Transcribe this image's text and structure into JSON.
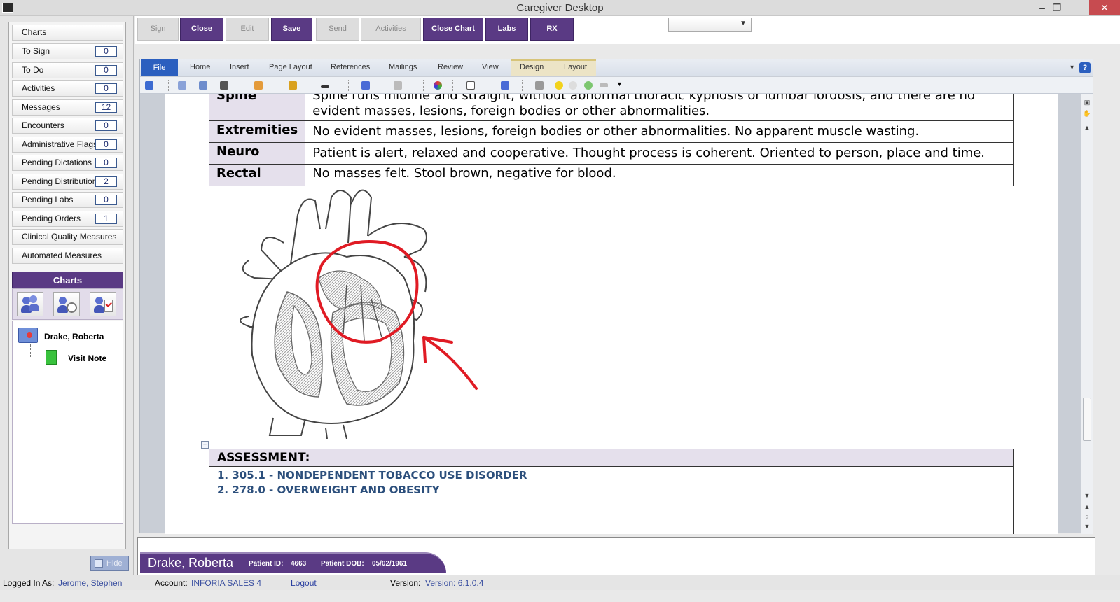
{
  "window": {
    "title": "Caregiver Desktop",
    "minimize": "–",
    "maximize": "❐",
    "close": "✕"
  },
  "sidebar": {
    "items": [
      {
        "label": "Charts",
        "count": null
      },
      {
        "label": "To Sign",
        "count": "0"
      },
      {
        "label": "To Do",
        "count": "0"
      },
      {
        "label": "Activities",
        "count": "0"
      },
      {
        "label": "Messages",
        "count": "12"
      },
      {
        "label": "Encounters",
        "count": "0"
      },
      {
        "label": "Administrative Flags",
        "count": "0"
      },
      {
        "label": "Pending Dictations",
        "count": "0"
      },
      {
        "label": "Pending Distributions",
        "count": "2"
      },
      {
        "label": "Pending Labs",
        "count": "0"
      },
      {
        "label": "Pending Orders",
        "count": "1"
      },
      {
        "label": "Clinical Quality Measures",
        "count": null
      },
      {
        "label": "Automated Measures",
        "count": null
      }
    ],
    "charts_header": "Charts",
    "tree": {
      "patient": "Drake, Roberta",
      "document": "Visit Note"
    },
    "hide_label": "Hide"
  },
  "toolbar": {
    "buttons": [
      {
        "label": "Sign",
        "enabled": false
      },
      {
        "label": "Close",
        "enabled": true
      },
      {
        "label": "Edit",
        "enabled": false
      },
      {
        "label": "Save",
        "enabled": true
      },
      {
        "label": "Send",
        "enabled": false
      },
      {
        "label": "Activities",
        "enabled": false
      },
      {
        "label": "Close Chart",
        "enabled": true
      },
      {
        "label": "Labs",
        "enabled": true
      },
      {
        "label": "RX",
        "enabled": true
      }
    ],
    "dropdown_value": ""
  },
  "ribbon": {
    "tabs": [
      "File",
      "Home",
      "Insert",
      "Page Layout",
      "References",
      "Mailings",
      "Review",
      "View",
      "Design",
      "Layout"
    ],
    "help": "?"
  },
  "document": {
    "exam_rows": [
      {
        "label": "Spine",
        "text": "Spine runs midline and straight, without abnormal thoracic kyphosis or lumbar lordosis, and there are no evident masses, lesions, foreign bodies or other abnormalities."
      },
      {
        "label": "Extremities",
        "text": "No evident masses, lesions, foreign bodies or other abnormalities. No apparent muscle wasting."
      },
      {
        "label": "Neuro",
        "text": "Patient is alert, relaxed and cooperative. Thought process is coherent. Oriented to person, place and time."
      },
      {
        "label": "Rectal",
        "text": "No masses felt.  Stool brown, negative for blood."
      }
    ],
    "assessment_title": "ASSESSMENT:",
    "assessment_items": [
      "1. 305.1 - NONDEPENDENT TOBACCO USE DISORDER",
      "2. 278.0 - OVERWEIGHT AND OBESITY"
    ]
  },
  "patient_bar": {
    "name": "Drake, Roberta",
    "id_label": "Patient ID:",
    "id": "4663",
    "dob_label": "Patient DOB:",
    "dob": "05/02/1961"
  },
  "status": {
    "logged_in_label": "Logged In As:",
    "logged_in_value": "Jerome, Stephen",
    "account_label": "Account:",
    "account_value": "INFORIA SALES 4",
    "logout": "Logout",
    "version_label": "Version:",
    "version_value": "Version: 6.1.0.4"
  },
  "colors": {
    "brand": "#5a3a84",
    "annotation": "#e01b24",
    "assessment_text": "#2c4f7c",
    "count_border": "#3b5a8f"
  },
  "icons": {
    "charts_toolbar": [
      "patient-search-icon",
      "patient-schedule-icon",
      "patient-checklist-icon"
    ]
  }
}
